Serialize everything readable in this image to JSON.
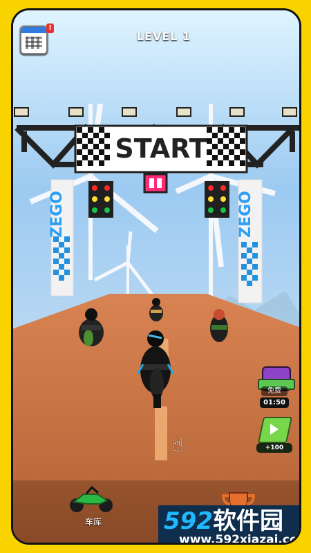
{
  "hud": {
    "level_label": "LEVEL 1",
    "calendar_icon": "calendar-icon",
    "notification_badge": "!"
  },
  "race": {
    "start_banner": "START",
    "sponsor_text": "ZEGO",
    "light_color": "#ff2a2a",
    "road_color": "#c97548",
    "sky_color": "#9ccaf1"
  },
  "rewards": {
    "free_label": "免费",
    "timer": "01:50",
    "video_reward": "+100"
  },
  "navigation": {
    "garage_label": "车库",
    "trophy_icon": "trophy-controller-icon"
  },
  "watermark": {
    "number": "592",
    "text": "软件园",
    "url": "www.592xiazai.com"
  },
  "icons": {
    "hand_pointer": "hand-pointer-icon",
    "play": "play-icon",
    "gift": "gift-box-icon",
    "motorcycle": "green-motorcycle-icon"
  }
}
